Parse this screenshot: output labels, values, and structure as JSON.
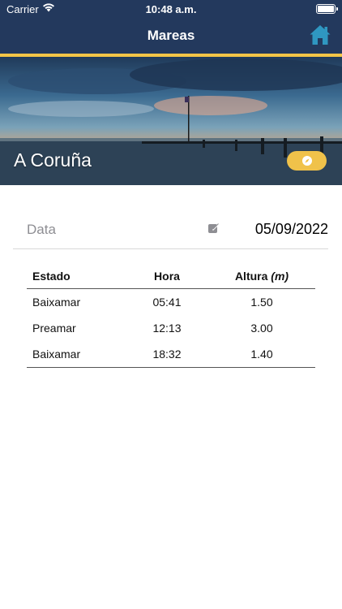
{
  "status": {
    "carrier": "Carrier",
    "time": "10:48 a.m."
  },
  "nav": {
    "title": "Mareas"
  },
  "hero": {
    "city": "A Coruña"
  },
  "date": {
    "label": "Data",
    "value": "05/09/2022"
  },
  "table": {
    "headers": {
      "estado": "Estado",
      "hora": "Hora",
      "altura": "Altura",
      "unit": "(m)"
    },
    "rows": [
      {
        "estado": "Baixamar",
        "hora": "05:41",
        "altura": "1.50"
      },
      {
        "estado": "Preamar",
        "hora": "12:13",
        "altura": "3.00"
      },
      {
        "estado": "Baixamar",
        "hora": "18:32",
        "altura": "1.40"
      }
    ]
  },
  "colors": {
    "nav": "#23395d",
    "accent": "#f3c547",
    "home_icon": "#2f97c1"
  },
  "icons": {
    "home": "home-icon",
    "compass": "compass-icon",
    "edit": "edit-icon",
    "wifi": "wifi-icon",
    "battery": "battery-icon"
  }
}
